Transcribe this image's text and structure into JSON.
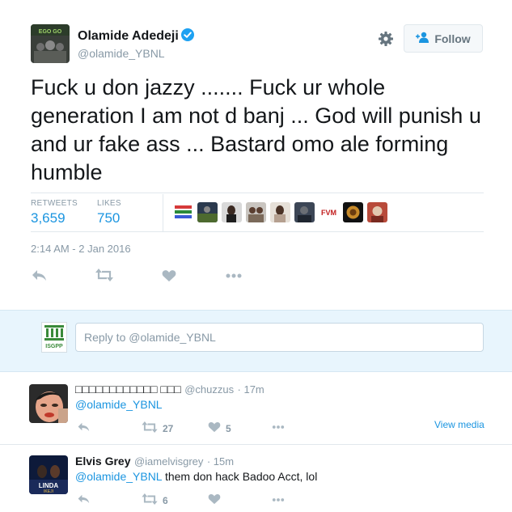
{
  "tweet": {
    "author_name": "Olamide Adedeji",
    "handle": "@olamide_YBNL",
    "follow_label": "Follow",
    "text": "Fuck u don jazzy ....... Fuck ur whole generation I am not d banj ... God will punish u and ur fake ass ... Bastard omo ale forming humble",
    "retweets_label": "RETWEETS",
    "retweets": "3,659",
    "likes_label": "LIKES",
    "likes": "750",
    "timestamp": "2:14 AM - 2 Jan 2016",
    "liker_icons": [
      "liker-avatar-1",
      "liker-avatar-2",
      "liker-avatar-3",
      "liker-avatar-4",
      "liker-avatar-5",
      "liker-avatar-6",
      "liker-avatar-fvm",
      "liker-avatar-8",
      "liker-avatar-9"
    ],
    "liker_fvm_text": "FVM"
  },
  "reply_box": {
    "placeholder": "Reply to @olamide_YBNL",
    "avatar_label": "ISGPP"
  },
  "replies": [
    {
      "name": "□□□□□□□□□□□□ □□□",
      "handle": "@chuzzus",
      "time": "· 17m",
      "mention": "@olamide_YBNL",
      "body": "",
      "retweets": "27",
      "likes": "5",
      "view_media": "View media"
    },
    {
      "name": "Elvis Grey",
      "handle": "@iamelvisgrey",
      "time": "· 15m",
      "mention": "@olamide_YBNL",
      "body": " them don hack Badoo Acct, lol",
      "retweets": "6",
      "likes": ""
    }
  ],
  "colors": {
    "link_blue": "#1b95e0",
    "muted_grey": "#8899a6",
    "verified_blue": "#1da1f2",
    "reply_bg": "#e8f5fd"
  }
}
